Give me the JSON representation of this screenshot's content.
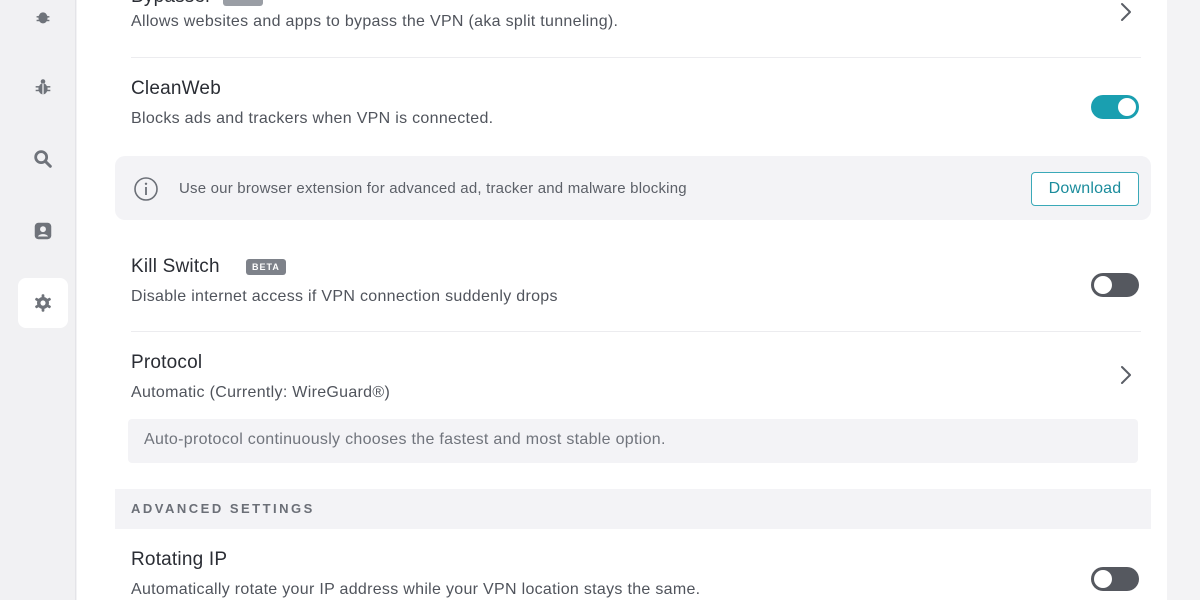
{
  "rail": {
    "items": [
      {
        "icon": "bug-icon"
      },
      {
        "icon": "bug-icon"
      },
      {
        "icon": "search-icon"
      },
      {
        "icon": "person-icon"
      },
      {
        "icon": "gear-icon",
        "active": true
      }
    ]
  },
  "settings": {
    "bypasser": {
      "title": "Bypasser",
      "description": "Allows websites and apps to bypass the VPN (aka split tunneling)."
    },
    "cleanweb": {
      "title": "CleanWeb",
      "description": "Blocks ads and trackers when VPN is connected.",
      "enabled": true
    },
    "extension_notice": {
      "text": "Use our browser extension for advanced ad, tracker and malware blocking",
      "button_label": "Download"
    },
    "kill_switch": {
      "title": "Kill Switch",
      "badge": "BETA",
      "description": "Disable internet access if VPN connection suddenly drops",
      "enabled": false
    },
    "protocol": {
      "title": "Protocol",
      "value": "Automatic (Currently: WireGuard®)",
      "note": "Auto-protocol continuously chooses the fastest and most stable option."
    },
    "advanced_header": "ADVANCED SETTINGS",
    "rotating_ip": {
      "title": "Rotating IP",
      "description": "Automatically rotate your IP address while your VPN location stays the same.",
      "enabled": false
    }
  },
  "colors": {
    "accent": "#1a9fb0",
    "toggle_off": "#55585f"
  }
}
